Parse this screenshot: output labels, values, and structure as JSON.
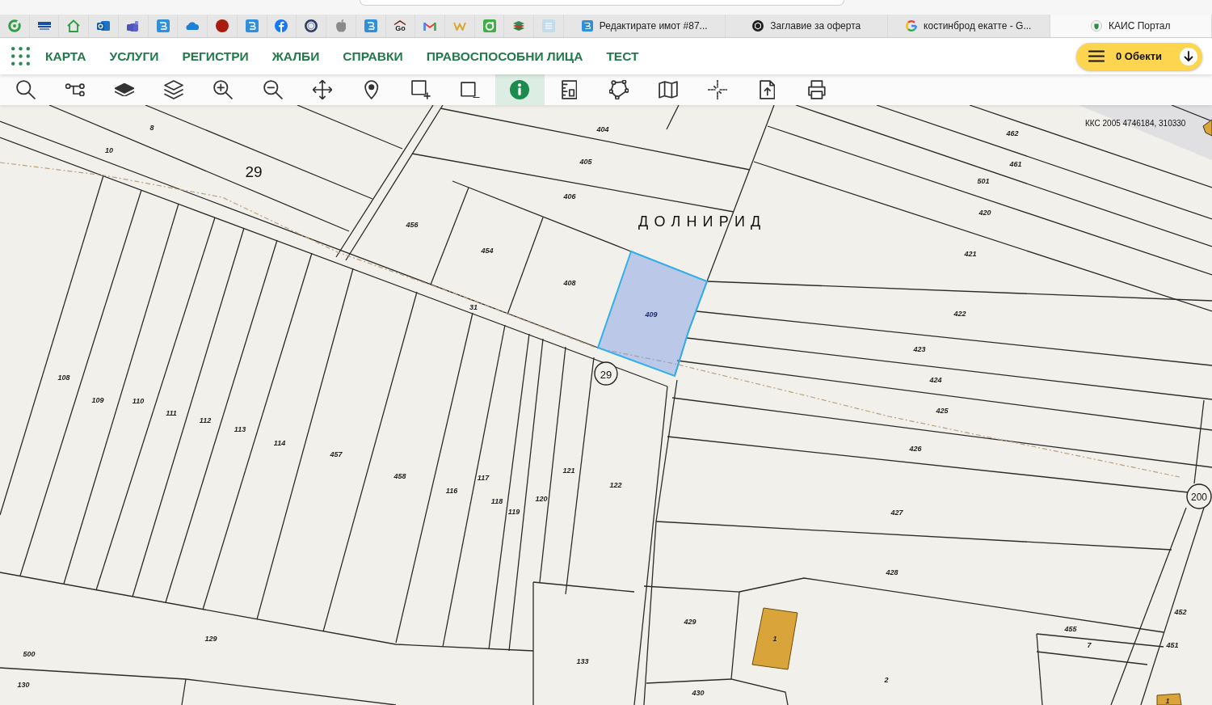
{
  "browser": {
    "pinned_tabs": [
      {
        "selected": false
      },
      {
        "selected": false
      },
      {
        "selected": false
      },
      {
        "selected": false
      },
      {
        "selected": false
      },
      {
        "selected": false
      },
      {
        "selected": false
      },
      {
        "selected": false
      },
      {
        "selected": false
      },
      {
        "selected": false
      },
      {
        "selected": false
      },
      {
        "selected": false
      },
      {
        "selected": false
      },
      {
        "selected": false,
        "icon_text": "Go"
      },
      {
        "selected": false
      },
      {
        "selected": false
      },
      {
        "selected": false
      },
      {
        "selected": false
      },
      {
        "selected": false
      }
    ],
    "tabs": [
      {
        "title": "Редактирате имот #87...",
        "selected": false
      },
      {
        "title": "Заглавие за оферта",
        "selected": false
      },
      {
        "title": "костинброд екатте - G...",
        "selected": false
      },
      {
        "title": "КАИС Портал",
        "selected": true
      }
    ]
  },
  "navbar": {
    "menu": [
      "КАРТА",
      "УСЛУГИ",
      "РЕГИСТРИ",
      "ЖАЛБИ",
      "СПРАВКИ",
      "ПРАВОСПОСОБНИ ЛИЦА",
      "ТЕСТ"
    ],
    "objects_button": "0 Обекти"
  },
  "toolbar": {
    "tools": [
      {
        "selected": false
      },
      {
        "selected": false
      },
      {
        "selected": false
      },
      {
        "selected": false
      },
      {
        "selected": false
      },
      {
        "selected": false
      },
      {
        "selected": false
      },
      {
        "selected": false
      },
      {
        "selected": false
      },
      {
        "selected": false
      },
      {
        "selected": true
      },
      {
        "selected": false
      },
      {
        "selected": false
      },
      {
        "selected": false
      },
      {
        "selected": false
      },
      {
        "selected": false
      },
      {
        "selected": false
      }
    ]
  },
  "map": {
    "coordinates": "ККС 2005 4746184, 310330",
    "locality": "ДОЛНИРИД",
    "road_labels": [
      {
        "text": "29",
        "kind": "plain"
      },
      {
        "text": "29",
        "kind": "circled"
      },
      {
        "text": "200",
        "kind": "circled"
      }
    ],
    "parcels": [
      {
        "number": "8",
        "selected": false
      },
      {
        "number": "10",
        "selected": false
      },
      {
        "number": "404",
        "selected": false
      },
      {
        "number": "462",
        "selected": false
      },
      {
        "number": "405",
        "selected": false
      },
      {
        "number": "461",
        "selected": false
      },
      {
        "number": "501",
        "selected": false
      },
      {
        "number": "406",
        "selected": false
      },
      {
        "number": "420",
        "selected": false
      },
      {
        "number": "456",
        "selected": false
      },
      {
        "number": "454",
        "selected": false
      },
      {
        "number": "421",
        "selected": false
      },
      {
        "number": "408",
        "selected": false
      },
      {
        "number": "31",
        "selected": false
      },
      {
        "number": "409",
        "selected": true
      },
      {
        "number": "422",
        "selected": false
      },
      {
        "number": "423",
        "selected": false
      },
      {
        "number": "108",
        "selected": false
      },
      {
        "number": "424",
        "selected": false
      },
      {
        "number": "109",
        "selected": false
      },
      {
        "number": "110",
        "selected": false
      },
      {
        "number": "425",
        "selected": false
      },
      {
        "number": "111",
        "selected": false
      },
      {
        "number": "112",
        "selected": false
      },
      {
        "number": "113",
        "selected": false
      },
      {
        "number": "114",
        "selected": false
      },
      {
        "number": "426",
        "selected": false
      },
      {
        "number": "457",
        "selected": false
      },
      {
        "number": "121",
        "selected": false
      },
      {
        "number": "458",
        "selected": false
      },
      {
        "number": "117",
        "selected": false
      },
      {
        "number": "122",
        "selected": false
      },
      {
        "number": "116",
        "selected": false
      },
      {
        "number": "120",
        "selected": false
      },
      {
        "number": "118",
        "selected": false
      },
      {
        "number": "119",
        "selected": false
      },
      {
        "number": "427",
        "selected": false
      },
      {
        "number": "428",
        "selected": false
      },
      {
        "number": "452",
        "selected": false
      },
      {
        "number": "429",
        "selected": false
      },
      {
        "number": "455",
        "selected": false
      },
      {
        "number": "129",
        "selected": false
      },
      {
        "number": "7",
        "selected": false
      },
      {
        "number": "451",
        "selected": false
      },
      {
        "number": "500",
        "selected": false
      },
      {
        "number": "133",
        "selected": false
      },
      {
        "number": "2",
        "selected": false
      },
      {
        "number": "130",
        "selected": false
      },
      {
        "number": "430",
        "selected": false
      }
    ],
    "buildings": [
      {
        "number": "1"
      },
      {
        "number": "1"
      }
    ]
  }
}
